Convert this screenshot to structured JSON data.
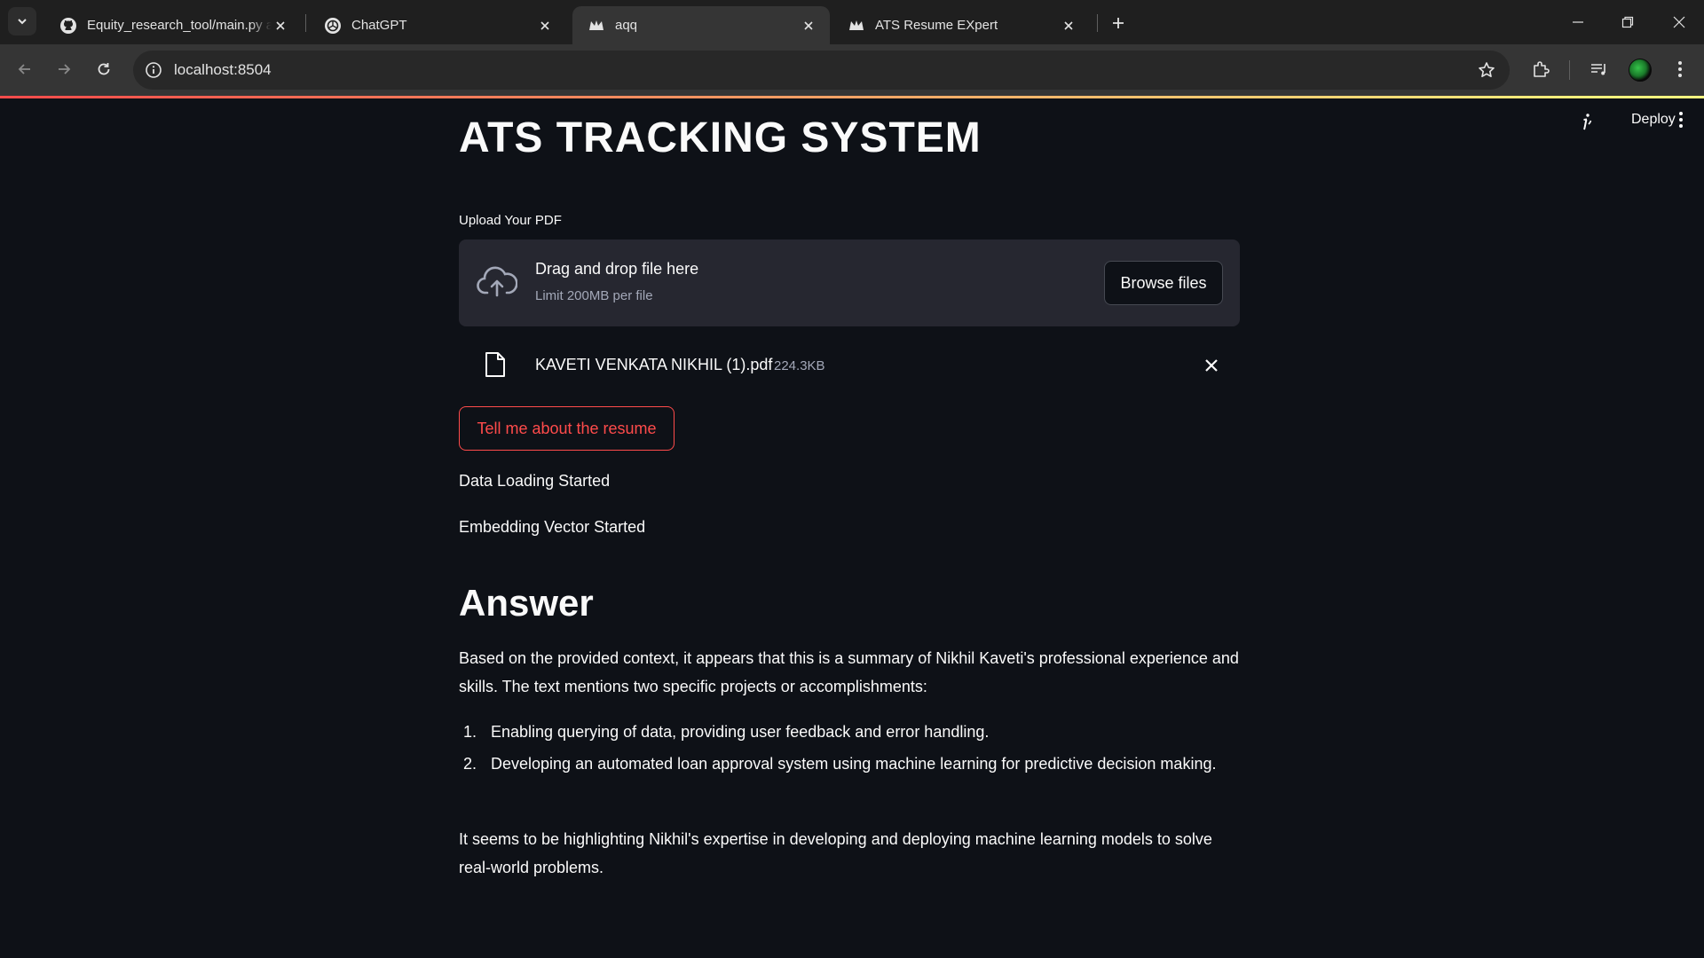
{
  "browser": {
    "tabs": [
      {
        "label": "Equity_research_tool/main.py at",
        "favicon": "github-icon"
      },
      {
        "label": "ChatGPT",
        "favicon": "openai-icon"
      },
      {
        "label": "aqq",
        "favicon": "streamlit-crown-icon",
        "active": true
      },
      {
        "label": "ATS Resume EXpert",
        "favicon": "streamlit-crown-icon"
      }
    ],
    "url": "localhost:8504"
  },
  "header": {
    "deploy_label": "Deploy"
  },
  "app": {
    "title": "ATS TRACKING SYSTEM",
    "upload": {
      "label": "Upload Your PDF",
      "drag_text": "Drag and drop file here",
      "limit_text": "Limit 200MB per file",
      "browse_label": "Browse files"
    },
    "file": {
      "name": "KAVETI VENKATA NIKHIL (1).pdf",
      "size": "224.3KB"
    },
    "action_button": "Tell me about the resume",
    "status": [
      "Data Loading Started",
      "Embedding Vector Started"
    ],
    "answer": {
      "heading": "Answer",
      "intro": "Based on the provided context, it appears that this is a summary of Nikhil Kaveti's professional experience and skills. The text mentions two specific projects or accomplishments:",
      "items": [
        {
          "num": "1.",
          "text": "Enabling querying of data, providing user feedback and error handling."
        },
        {
          "num": "2.",
          "text": "Developing an automated loan approval system using machine learning for predictive decision making."
        }
      ],
      "closing": "It seems to be highlighting Nikhil's expertise in developing and deploying machine learning models to solve real-world problems."
    }
  },
  "colors": {
    "accent": "#ff4b4b",
    "background": "#0e1117",
    "surface": "#262730"
  }
}
